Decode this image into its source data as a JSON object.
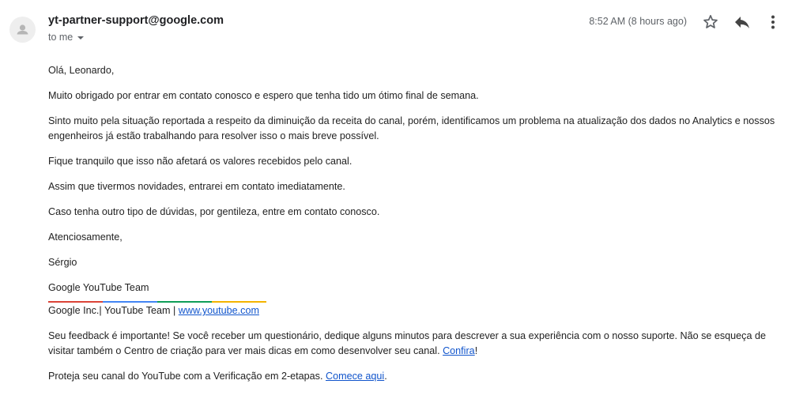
{
  "header": {
    "sender": "yt-partner-support@google.com",
    "recipient": "to me",
    "time": "8:52 AM (8 hours ago)",
    "icons": [
      "person-icon",
      "star-icon",
      "reply-icon",
      "more-vert-icon"
    ]
  },
  "message": {
    "greeting": "Olá, Leonardo,",
    "p1": "Muito obrigado por entrar em contato conosco e espero que tenha tido um ótimo final de semana.",
    "p2": "Sinto muito pela situação reportada a respeito da diminuição da receita do canal, porém, identificamos um problema na atualização dos dados no Analytics e nossos engenheiros já estão trabalhando para resolver isso o mais breve possível.",
    "p3": "Fique tranquilo que isso não afetará os valores recebidos pelo canal.",
    "p4": "Assim que tivermos novidades, entrarei em contato imediatamente.",
    "p5": "Caso tenha outro tipo de dúvidas, por gentileza, entre em contato conosco.",
    "closing": "Atenciosamente,",
    "name": "Sérgio",
    "team": "Google YouTube Team"
  },
  "signature": {
    "text": "Google Inc.| YouTube Team | ",
    "link": "www.youtube.com",
    "colors": [
      "#db4437",
      "#4285f4",
      "#0f9d58",
      "#f4b400"
    ]
  },
  "footer": {
    "feedback_text": "Seu feedback é importante! Se você receber um questionário, dedique alguns minutos para descrever a sua experiência com o nosso suporte. Não se esqueça de visitar também o Centro de criação para ver mais dicas em como desenvolver seu canal. ",
    "feedback_link": "Confira",
    "feedback_end": "!",
    "verify_text": "Proteja seu canal do YouTube com a Verificação em 2-etapas. ",
    "verify_link": "Comece aqui",
    "verify_end": "."
  }
}
